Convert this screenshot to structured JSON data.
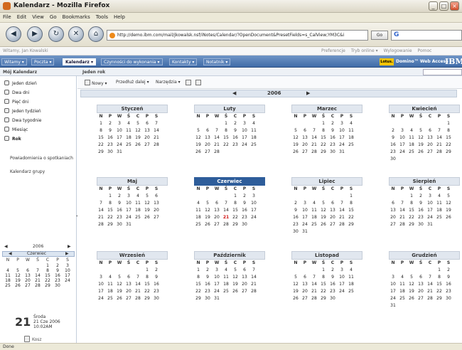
{
  "window": {
    "title": "Kalendarz - Mozilla Firefox"
  },
  "menubar": [
    "File",
    "Edit",
    "View",
    "Go",
    "Bookmarks",
    "Tools",
    "Help"
  ],
  "nav": {
    "url": "http://demo.ibm.com/mail/jkowalsk.nsf/iNotes/Calendar/?OpenDocument&PresetFields=s_CalView;YM3C&i",
    "go_label": "Go",
    "search_value": "G"
  },
  "userbar": {
    "user": "Witamy, Jan Kowalski",
    "links": [
      "Preferencje",
      "Tryb online ▾",
      "Wylogowanie",
      "Pomoc"
    ]
  },
  "tabs": [
    {
      "label": "Witamy ▾"
    },
    {
      "label": "Poczta ▾"
    },
    {
      "label": "Kalendarz ▾",
      "active": true
    },
    {
      "label": "Czynności do wykonania ▾"
    },
    {
      "label": "Kontakty ▾"
    },
    {
      "label": "Notatnik ▾"
    }
  ],
  "branding": {
    "lotus": "Lotus.",
    "domino": "Domino™ Web Access",
    "ibm": "IBM"
  },
  "section": {
    "left": "Mój Kalendarz",
    "center": "Jeden rok"
  },
  "views": [
    {
      "label": "Jeden dzień"
    },
    {
      "label": "Dwa dni"
    },
    {
      "label": "Pięć dni"
    },
    {
      "label": "Jeden tydzień"
    },
    {
      "label": "Dwa tygodnie"
    },
    {
      "label": "Miesiąc"
    },
    {
      "label": "Rok",
      "active": true
    }
  ],
  "sidelinks": [
    "Powiadomienia o spotkaniach",
    "Kalendarz grupy"
  ],
  "minical": {
    "year": "2006",
    "month": "Czerwiec",
    "weekdays": [
      "N",
      "P",
      "W",
      "Ś",
      "C",
      "P",
      "S"
    ],
    "weeks": [
      [
        "",
        "",
        "",
        "",
        "1",
        "2",
        "3"
      ],
      [
        "4",
        "5",
        "6",
        "7",
        "8",
        "9",
        "10"
      ],
      [
        "11",
        "12",
        "13",
        "14",
        "15",
        "16",
        "17"
      ],
      [
        "18",
        "19",
        "20",
        "21",
        "22",
        "23",
        "24"
      ],
      [
        "25",
        "26",
        "27",
        "28",
        "29",
        "30",
        ""
      ]
    ]
  },
  "today": {
    "day": "21",
    "dayname": "Środa",
    "date": "21 Cze 2006",
    "time": "10:02AM"
  },
  "trash": "Kosz",
  "actions": [
    "Nowy ▾",
    "Przedłuż dalej ▾",
    "Narzędzia ▾"
  ],
  "year": "2006",
  "weekdays": [
    "N",
    "P",
    "W",
    "Ś",
    "C",
    "P",
    "S"
  ],
  "months": [
    {
      "name": "Styczeń",
      "weeks": [
        [
          "1",
          "2",
          "3",
          "4",
          "5",
          "6",
          "7"
        ],
        [
          "8",
          "9",
          "10",
          "11",
          "12",
          "13",
          "14"
        ],
        [
          "15",
          "16",
          "17",
          "18",
          "19",
          "20",
          "21"
        ],
        [
          "22",
          "23",
          "24",
          "25",
          "26",
          "27",
          "28"
        ],
        [
          "29",
          "30",
          "31",
          "",
          "",
          "",
          ""
        ]
      ]
    },
    {
      "name": "Luty",
      "weeks": [
        [
          "",
          "",
          "",
          "1",
          "2",
          "3",
          "4"
        ],
        [
          "5",
          "6",
          "7",
          "8",
          "9",
          "10",
          "11"
        ],
        [
          "12",
          "13",
          "14",
          "15",
          "16",
          "17",
          "18"
        ],
        [
          "19",
          "20",
          "21",
          "22",
          "23",
          "24",
          "25"
        ],
        [
          "26",
          "27",
          "28",
          "",
          "",
          "",
          ""
        ]
      ]
    },
    {
      "name": "Marzec",
      "weeks": [
        [
          "",
          "",
          "",
          "1",
          "2",
          "3",
          "4"
        ],
        [
          "5",
          "6",
          "7",
          "8",
          "9",
          "10",
          "11"
        ],
        [
          "12",
          "13",
          "14",
          "15",
          "16",
          "17",
          "18"
        ],
        [
          "19",
          "20",
          "21",
          "22",
          "23",
          "24",
          "25"
        ],
        [
          "26",
          "27",
          "28",
          "29",
          "30",
          "31",
          ""
        ]
      ]
    },
    {
      "name": "Kwiecień",
      "weeks": [
        [
          "",
          "",
          "",
          "",
          "",
          "",
          "1"
        ],
        [
          "2",
          "3",
          "4",
          "5",
          "6",
          "7",
          "8"
        ],
        [
          "9",
          "10",
          "11",
          "12",
          "13",
          "14",
          "15"
        ],
        [
          "16",
          "17",
          "18",
          "19",
          "20",
          "21",
          "22"
        ],
        [
          "23",
          "24",
          "25",
          "26",
          "27",
          "28",
          "29"
        ],
        [
          "30",
          "",
          "",
          "",
          "",
          "",
          ""
        ]
      ]
    },
    {
      "name": "Maj",
      "weeks": [
        [
          "",
          "1",
          "2",
          "3",
          "4",
          "5",
          "6"
        ],
        [
          "7",
          "8",
          "9",
          "10",
          "11",
          "12",
          "13"
        ],
        [
          "14",
          "15",
          "16",
          "17",
          "18",
          "19",
          "20"
        ],
        [
          "21",
          "22",
          "23",
          "24",
          "25",
          "26",
          "27"
        ],
        [
          "28",
          "29",
          "30",
          "31",
          "",
          "",
          ""
        ]
      ]
    },
    {
      "name": "Czerwiec",
      "selected": true,
      "today": "21",
      "weeks": [
        [
          "",
          "",
          "",
          "",
          "1",
          "2",
          "3"
        ],
        [
          "4",
          "5",
          "6",
          "7",
          "8",
          "9",
          "10"
        ],
        [
          "11",
          "12",
          "13",
          "14",
          "15",
          "16",
          "17"
        ],
        [
          "18",
          "19",
          "20",
          "21",
          "22",
          "23",
          "24"
        ],
        [
          "25",
          "26",
          "27",
          "28",
          "29",
          "30",
          ""
        ]
      ]
    },
    {
      "name": "Lipiec",
      "weeks": [
        [
          "",
          "",
          "",
          "",
          "",
          "",
          "1"
        ],
        [
          "2",
          "3",
          "4",
          "5",
          "6",
          "7",
          "8"
        ],
        [
          "9",
          "10",
          "11",
          "12",
          "13",
          "14",
          "15"
        ],
        [
          "16",
          "17",
          "18",
          "19",
          "20",
          "21",
          "22"
        ],
        [
          "23",
          "24",
          "25",
          "26",
          "27",
          "28",
          "29"
        ],
        [
          "30",
          "31",
          "",
          "",
          "",
          "",
          ""
        ]
      ]
    },
    {
      "name": "Sierpień",
      "weeks": [
        [
          "",
          "",
          "1",
          "2",
          "3",
          "4",
          "5"
        ],
        [
          "6",
          "7",
          "8",
          "9",
          "10",
          "11",
          "12"
        ],
        [
          "13",
          "14",
          "15",
          "16",
          "17",
          "18",
          "19"
        ],
        [
          "20",
          "21",
          "22",
          "23",
          "24",
          "25",
          "26"
        ],
        [
          "27",
          "28",
          "29",
          "30",
          "31",
          "",
          ""
        ]
      ]
    },
    {
      "name": "Wrzesień",
      "weeks": [
        [
          "",
          "",
          "",
          "",
          "",
          "1",
          "2"
        ],
        [
          "3",
          "4",
          "5",
          "6",
          "7",
          "8",
          "9"
        ],
        [
          "10",
          "11",
          "12",
          "13",
          "14",
          "15",
          "16"
        ],
        [
          "17",
          "18",
          "19",
          "20",
          "21",
          "22",
          "23"
        ],
        [
          "24",
          "25",
          "26",
          "27",
          "28",
          "29",
          "30"
        ]
      ]
    },
    {
      "name": "Październik",
      "weeks": [
        [
          "1",
          "2",
          "3",
          "4",
          "5",
          "6",
          "7"
        ],
        [
          "8",
          "9",
          "10",
          "11",
          "12",
          "13",
          "14"
        ],
        [
          "15",
          "16",
          "17",
          "18",
          "19",
          "20",
          "21"
        ],
        [
          "22",
          "23",
          "24",
          "25",
          "26",
          "27",
          "28"
        ],
        [
          "29",
          "30",
          "31",
          "",
          "",
          "",
          ""
        ]
      ]
    },
    {
      "name": "Listopad",
      "weeks": [
        [
          "",
          "",
          "",
          "1",
          "2",
          "3",
          "4"
        ],
        [
          "5",
          "6",
          "7",
          "8",
          "9",
          "10",
          "11"
        ],
        [
          "12",
          "13",
          "14",
          "15",
          "16",
          "17",
          "18"
        ],
        [
          "19",
          "20",
          "21",
          "22",
          "23",
          "24",
          "25"
        ],
        [
          "26",
          "27",
          "28",
          "29",
          "30",
          "",
          ""
        ]
      ]
    },
    {
      "name": "Grudzień",
      "weeks": [
        [
          "",
          "",
          "",
          "",
          "",
          "1",
          "2"
        ],
        [
          "3",
          "4",
          "5",
          "6",
          "7",
          "8",
          "9"
        ],
        [
          "10",
          "11",
          "12",
          "13",
          "14",
          "15",
          "16"
        ],
        [
          "17",
          "18",
          "19",
          "20",
          "21",
          "22",
          "23"
        ],
        [
          "24",
          "25",
          "26",
          "27",
          "28",
          "29",
          "30"
        ],
        [
          "31",
          "",
          "",
          "",
          "",
          "",
          ""
        ]
      ]
    }
  ],
  "status": "Done"
}
